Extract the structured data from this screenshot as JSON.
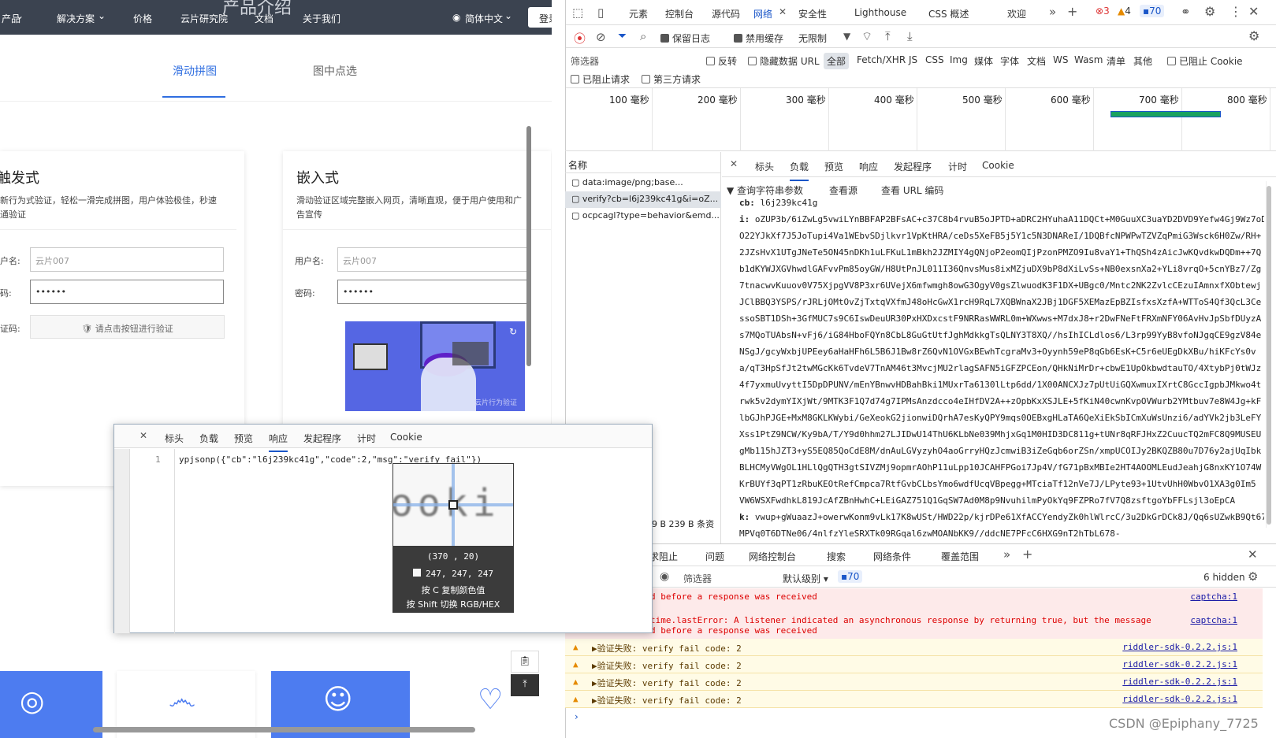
{
  "site": {
    "nav": [
      "产品",
      "解决方案",
      "价格",
      "云片研究院",
      "文档",
      "关于我们",
      "简体中文",
      "登录"
    ],
    "ghost_title": "产品介绍",
    "tabs": [
      "滑动拼图",
      "图中点选"
    ],
    "card1": {
      "title": "触发式",
      "desc": "新行为式验证，轻松一滑完成拼图，用户体验极佳，秒速通验证",
      "username_label": "户名:",
      "username_value": "云片007",
      "password_label": "码:",
      "password_value": "••••••",
      "captcha_label": "证码:",
      "verify_button": "请点击按钮进行验证"
    },
    "card2": {
      "title": "嵌入式",
      "desc": "滑动验证区域完整嵌入网页，清晰直观，便于用户使用和广告宣传",
      "username_label": "用户名:",
      "username_value": "云片007",
      "password_label": "密码:",
      "password_value": "••••••",
      "watermark": "云片行为验证"
    }
  },
  "devtools": {
    "tabs": [
      "元素",
      "控制台",
      "源代码",
      "网络",
      "安全性",
      "Lighthouse",
      "CSS 概述",
      "欢迎"
    ],
    "counts": {
      "errors": "3",
      "warnings": "4",
      "info": "70"
    },
    "toolbar": {
      "preserve_log": "保留日志",
      "disable_cache": "禁用缓存",
      "throttle": "无限制"
    },
    "filter": {
      "placeholder": "筛选器",
      "invert": "反转",
      "hide_data": "隐藏数据 URL",
      "all": "全部",
      "types": [
        "Fetch/XHR",
        "JS",
        "CSS",
        "Img",
        "媒体",
        "字体",
        "文档",
        "WS",
        "Wasm",
        "清单",
        "其他"
      ],
      "blocked_cookies": "已阻止 Cookie",
      "blocked_requests": "已阻止请求",
      "third_party": "第三方请求"
    },
    "timeline_ticks": [
      "100 毫秒",
      "200 毫秒",
      "300 毫秒",
      "400 毫秒",
      "500 毫秒",
      "600 毫秒",
      "700 毫秒",
      "800 毫秒"
    ],
    "names_header": "名称",
    "requests": [
      "data:image/png;base...",
      "verify?cb=l6j239kc41g&i=oZ...",
      "ocpcagl?type=behavior&emd..."
    ],
    "status_summary": "9 B 239 B 条资",
    "detail_tabs": [
      "标头",
      "负载",
      "预览",
      "响应",
      "发起程序",
      "计时",
      "Cookie"
    ],
    "payload": {
      "section": "查询字符串参数",
      "view_source": "查看源",
      "view_url": "查看 URL 编码",
      "cb_key": "cb:",
      "cb": "l6j239kc41g",
      "i_key": "i:",
      "i_lines": [
        "oZUP3b/6iZwLg5vwiLYnBBFAP2BFsAC+c37C8b4rvuB5oJPTD+aDRC2HYuhaA11DQCt+M0GuuXC3uaYD2DVD9Yefw4Gj9Wz7oD",
        "O22YJkXf7J5JoTupi4Va1WEbvSDjlkvr1VpKtHRA/ceDs5XeFB5j5Y1c5N3DNAReI/1DQBfcNPWPwTZVZqPmiG3Wsck6H0Zw/RH+",
        "2JZsHvX1UTgJNeTe5ON45nDKh1uLFKuL1mBkh2JZMIY4gQNjoP2eomQIjPzonPMZO9Iu8vaY1+ThQSh4zAicJwKQvdkwDQDm++7Q",
        "b1dKYWJXGVhwdlGAFvvPm85oyGW/H8UtPnJL011I36QnvsMus8ixMZjuDX9bP8dXiLvSs+NB0exsnXa2+YLi8vrqO+5cnYBz7/Zg",
        "7tnacwvKuuov0V75XjpgVV8P3xr6UVejX6mfwmgh8owG3OgyV0gsZlwuodK3F1DX+UBgc0/Mntc2NK2ZvlcCEzuIAmnxfXObtewj",
        "JClBBQ3YSPS/rJRLjOMtOvZjTxtqVXfmJ48oHcGwX1rcH9RqL7XQBWnaX2JBj1DGF5XEMazEpBZIsfxsXzfA+WTToS4Qf3QcL3Ce",
        "ssoSBT1DSh+3GfMUC7s9C6IswDeuUR30PxHXDxcstF9NRRasWWRL0m+WXwws+M7dxJ8+r2DwFNeFtFRXmNFY06AvHvJpSbfDUyzA",
        "s7MQoTUAbsN+vFj6/iG84HboFQYn8CbL8GuGtUtfJghMdkkgTsQLNY3T8XQ//hsIhICLdlos6/L3rp99YyB8vfoNJgqCE9gzV84e",
        "NSgJ/gcyWxbjUPEey6aHaHFh6L5B6J1Bw8rZ6QvN1OVGxBEwhTcgraMv3+Oyynh59eP8qGb6EsK+C5r6eUEgDkXBu/hiKFcYs0v",
        "a/qT3HpSfJt2twMGcKk6TvdeV7TnAM46t3MvcjMU2rlagSAFN5iGFZPCEon/QHkNiMrDr+cbwE1UpOkbwdtauTO/4XtybPj0tWJz",
        "4f7yxmuUvyttI5DpDPUNV/mEnYBnwvHDBahBki1MUxrTa6130lLtp6dd/1X00ANCXJz7pUtUiGQXwmuxIXrtC8GccIgpbJMkwo4t",
        "rwk5v2dymYIXjWt/9MTK3F1Q7d74g7IPMsAnzdcco4eIHfDV2A++zOpbKxXSJLE+5fKiN40cwnKvpOVWurb2YMtbuv7e8W4Jg+kF",
        "lbGJhPJGE+MxM8GKLKWybi/GeXeokG2jionwiDQrhA7esKyQPY9mqs0OEBxgHLaTA6QeXiEkSbICmXuWsUnzi6/adYVk2jb3LeFY",
        "Xss1PtZ9NCW/Ky9bA/T/Y9d0hhm27LJIDwU14ThU6KLbNe039MhjxGq1M0HID3DC811g+tUNr8qRFJHxZ2CuucTQ2mFC8Q9MUSEU",
        "gMb115hJZT3+yS5EQ85QoCdE8M/dnAuLGVyzyhO4aoGrryHQzJcmwiB3iZeGqb6orZSn/xmpUCOIJy2BKQZB80u7D76y2ajUqIbk",
        "BLHCMyVWgOL1HLlQgQTH3gtSIVZMj9opmrAOhP11uLpp10JCAHFPGoi7Jp4V/fG71pBxMBIe2HT4AOOMLEudJeahjG8nxKY1O74W",
        "KrBUYf3qPT1zRbuKEOtRefCmpca7RtfGvbCLbsYmo6wdfUcqVBpegg+MTciaTf12nVe7J/LPyte93+1UtvUhH0WbvO1XA3g0Im5",
        "VW6WSXFwdhkL819JcAfZBnHwhC+LEiGAZ751Q1GqSW7Ad0M8p9NvuhilmPyOkYq9FZPRo7fV7Q8zsftgoYbFFLsjl3oEpCA"
      ],
      "k_key": "k:",
      "k": "vwup+gWuaazJ+owerwKonm9vLk17K8wUSt/HWD22p/kjrDPe61XfACCYendyZk0hlWlrcC/3u2DkGrDCk8J/Qq6sUZwkB9Qt67",
      "k2": "MPVq0T6DTNe06/4nlfzYleSRXTk09RGqal6zwMOANbKK9//ddcNE7PFcC6HXG9nT2hTbL678-"
    },
    "drawer_tabs": [
      "求阻止",
      "问题",
      "网络控制台",
      "搜索",
      "网络条件",
      "覆盖范围"
    ],
    "console": {
      "filter_placeholder": "筛选器",
      "level": "默认级别",
      "badge": "70",
      "hidden": "6 hidden",
      "err1a": "d before a response was received",
      "err2": "time.lastError: A listener indicated an asynchronous response by returning true, but the message",
      "err2b": "d before a response was received",
      "err_src": "captcha:1",
      "warn_text": "▶验证失败: verify fail code: 2",
      "warn_src": "riddler-sdk-0.2.2.js:1"
    },
    "watermark": "CSDN @Epiphany_7725"
  },
  "panel": {
    "tabs": [
      "标头",
      "负载",
      "预览",
      "响应",
      "发起程序",
      "计时",
      "Cookie"
    ],
    "line_no": "1",
    "response": "ypjsonp({\"cb\":\"l6j239kc41g\",\"code\":2,\"msg\":\"verify fail\"})",
    "picker": {
      "coords": "(370 , 20)",
      "rgb": "247, 247, 247",
      "hint1": "按 C 复制颜色值",
      "hint2": "按 Shift 切换 RGB/HEX",
      "zoom_text": "ooki"
    }
  }
}
